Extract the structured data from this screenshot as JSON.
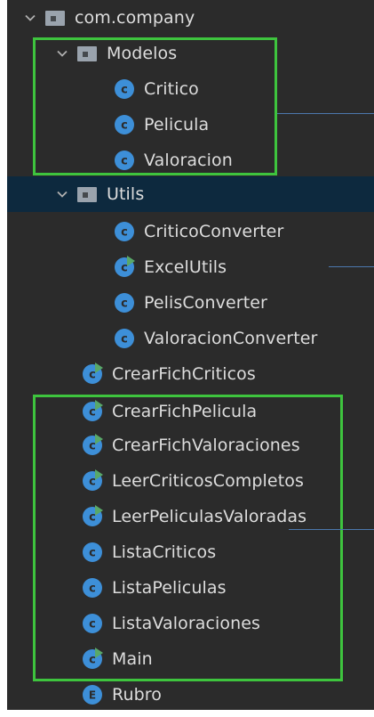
{
  "tree": {
    "root": {
      "label": "com.company"
    },
    "modelos": {
      "label": "Modelos",
      "items": [
        {
          "label": "Critico"
        },
        {
          "label": "Pelicula"
        },
        {
          "label": "Valoracion"
        }
      ]
    },
    "utils": {
      "label": "Utils",
      "items": [
        {
          "label": "CriticoConverter"
        },
        {
          "label": "ExcelUtils"
        },
        {
          "label": "PelisConverter"
        },
        {
          "label": "ValoracionConverter"
        }
      ]
    },
    "classes": [
      {
        "label": "CrearFichCriticos"
      },
      {
        "label": "CrearFichPelicula"
      },
      {
        "label": "CrearFichValoraciones"
      },
      {
        "label": "LeerCriticosCompletos"
      },
      {
        "label": "LeerPeliculasValoradas"
      },
      {
        "label": "ListaCriticos"
      },
      {
        "label": "ListaPeliculas"
      },
      {
        "label": "ListaValoraciones"
      },
      {
        "label": "Main"
      }
    ],
    "enum": {
      "label": "Rubro"
    }
  },
  "icons": {
    "class_glyph": "c",
    "enum_glyph": "E"
  },
  "colors": {
    "background": "#2b2b2b",
    "selected_row": "#0d293e",
    "class_icon": "#3d8fd8",
    "run_marker": "#59a869",
    "highlight_box": "#3ec43e",
    "connector_line": "#4c78ad"
  }
}
